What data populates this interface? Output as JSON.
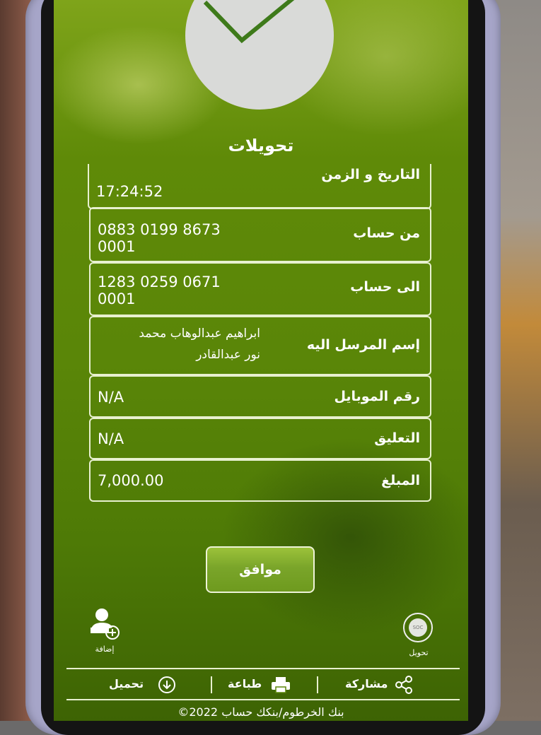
{
  "screen": {
    "title": "تحويلات",
    "rows": [
      {
        "label": "التاريخ و الزمن",
        "value": "17:24:52"
      },
      {
        "label": "من حساب",
        "value": "0883 0199 8673\n0001"
      },
      {
        "label": "الى حساب",
        "value": "1283 0259 0671\n0001"
      },
      {
        "label": "إسم المرسل اليه",
        "value": "ابراهيم عبدالوهاب محمد\nنور عبدالقادر"
      },
      {
        "label": "رقم الموبايل",
        "value": "N/A"
      },
      {
        "label": "التعليق",
        "value": "N/A"
      },
      {
        "label": "المبلغ",
        "value": "7,000.00"
      }
    ],
    "ok_label": "موافق",
    "add_label": "إضافة",
    "transfer_label": "تحويل",
    "soc_label": "SOC",
    "toolbar": {
      "download_label": "تحميل",
      "print_label": "طباعة",
      "share_label": "مشاركة"
    },
    "footer": "©2022 بنك الخرطوم/بنكك حساب"
  },
  "colors": {
    "screen_green": "#5a8608",
    "button_green": "#7aa52a",
    "check_mark": "#3e7a1a",
    "circle_gray": "#d9dad8"
  }
}
